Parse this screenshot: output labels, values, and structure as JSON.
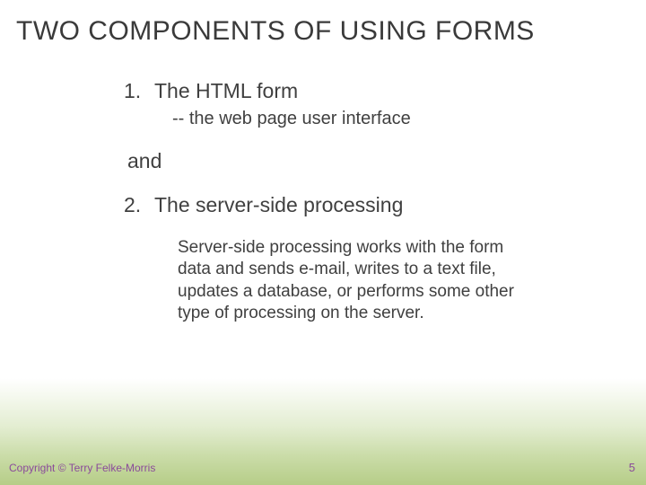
{
  "title": "TWO COMPONENTS OF USING FORMS",
  "item1": {
    "num": "1.",
    "label": "The HTML form",
    "sub": "-- the web page user interface"
  },
  "connector": "and",
  "item2": {
    "num": "2.",
    "label": "The server-side processing",
    "desc": "Server-side processing works with the form data and sends e-mail, writes to a text file, updates a database, or performs some other type of processing on the server."
  },
  "copyright": "Copyright © Terry Felke-Morris",
  "page_number": "5"
}
